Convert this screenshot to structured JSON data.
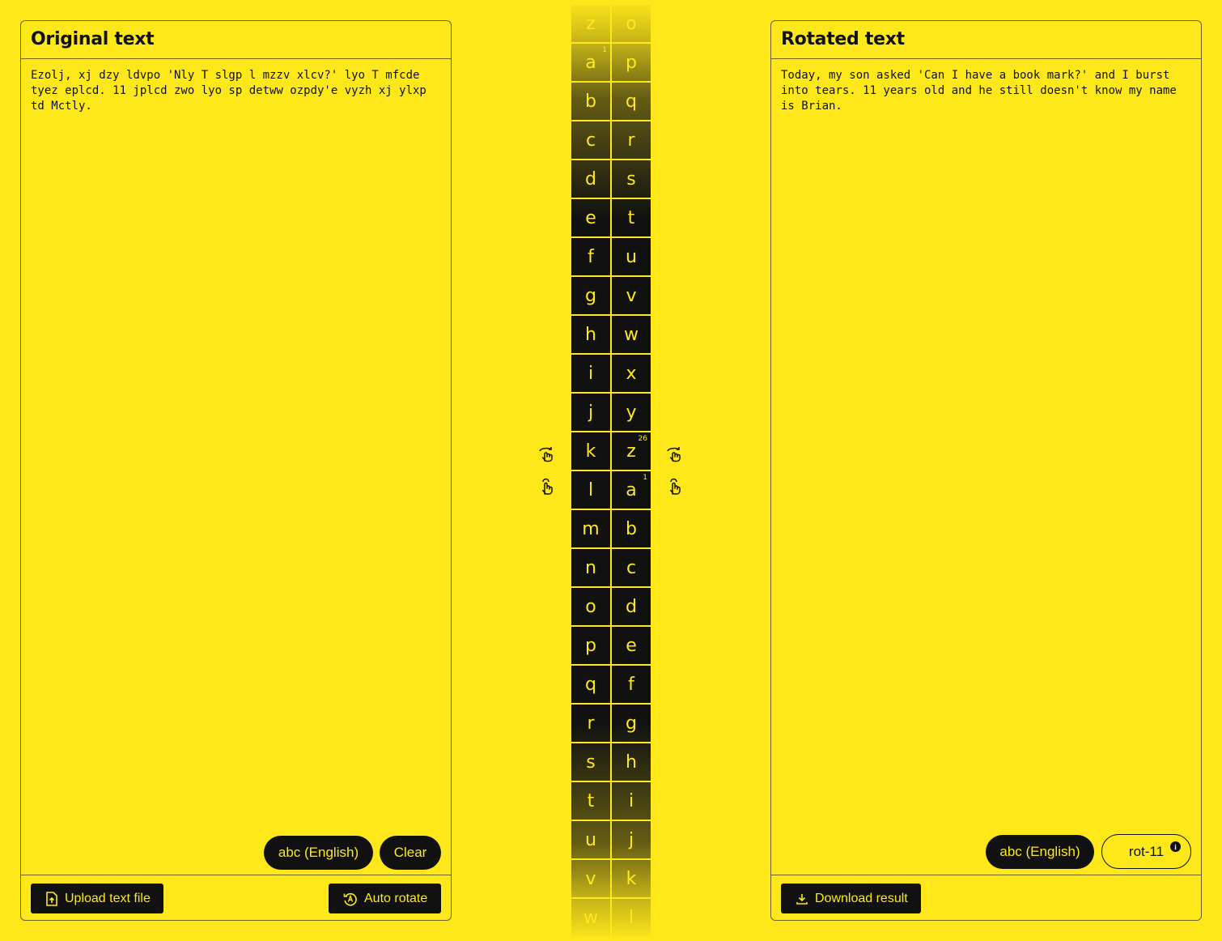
{
  "left": {
    "title": "Original text",
    "text": "Ezolj, xj dzy ldvpo 'Nly T slgp l mzzv xlcv?' lyo T mfcde tyez eplcd. 11 jplcd zwo lyo sp detww ozpdy'e vyzh xj ylxp td Mctly.",
    "alphabet_label": "abc (English)",
    "clear_label": "Clear",
    "upload_label": "Upload text file",
    "auto_rotate_label": "Auto rotate"
  },
  "right": {
    "title": "Rotated text",
    "text": "Today, my son asked 'Can I have a book mark?' and I burst into tears. 11 years old and he still doesn't know my name is Brian.",
    "alphabet_label": "abc (English)",
    "rotation_label": "rot-11",
    "info_glyph": "i",
    "download_label": "Download result"
  },
  "wheel": {
    "left_column": [
      "z",
      "a",
      "b",
      "c",
      "d",
      "e",
      "f",
      "g",
      "h",
      "i",
      "j",
      "k",
      "l",
      "m",
      "n",
      "o",
      "p",
      "q",
      "r",
      "s",
      "t",
      "u",
      "v",
      "w"
    ],
    "right_column": [
      "o",
      "p",
      "q",
      "r",
      "s",
      "t",
      "u",
      "v",
      "w",
      "x",
      "y",
      "z",
      "a",
      "b",
      "c",
      "d",
      "e",
      "f",
      "g",
      "h",
      "i",
      "j",
      "k",
      "l"
    ],
    "left_index_marker": {
      "row": 1,
      "label": "1"
    },
    "right_index_markers": [
      {
        "row": 11,
        "label": "26"
      },
      {
        "row": 12,
        "label": "1"
      }
    ],
    "selected_row": 11,
    "rotation": 11
  },
  "icons": {
    "rotate_left": "hand-rotate-icon",
    "tap_left": "hand-tap-icon",
    "rotate_right": "hand-rotate-icon",
    "tap_right": "hand-tap-icon"
  },
  "colors": {
    "background": "#ffe81a",
    "dark": "#111111",
    "accent_text": "#ffe81a"
  }
}
